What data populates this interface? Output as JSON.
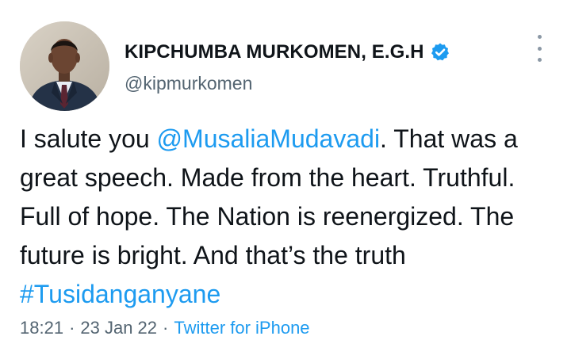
{
  "author": {
    "display_name": "KIPCHUMBA MURKOMEN, E.G.H",
    "handle": "@kipmurkomen",
    "verified_icon": "verified-badge-icon",
    "avatar_icon": "profile-photo"
  },
  "tweet": {
    "text_1": "I salute you ",
    "mention": "@MusaliaMudavadi",
    "text_2": ". That was a great speech. Made from the heart. Truthful. Full of hope. The Nation is reenergized. The future is bright. And that’s the truth ",
    "hashtag": "#Tusidanganyane"
  },
  "meta": {
    "time": "18:21",
    "date": "23 Jan 22",
    "separator": "·",
    "source": "Twitter for iPhone"
  },
  "more_icon": "more-options-icon",
  "colors": {
    "link": "#1d9bf0",
    "secondary_text": "#536471",
    "primary_text": "#0f1419",
    "icon_gray": "#8b98a5"
  }
}
